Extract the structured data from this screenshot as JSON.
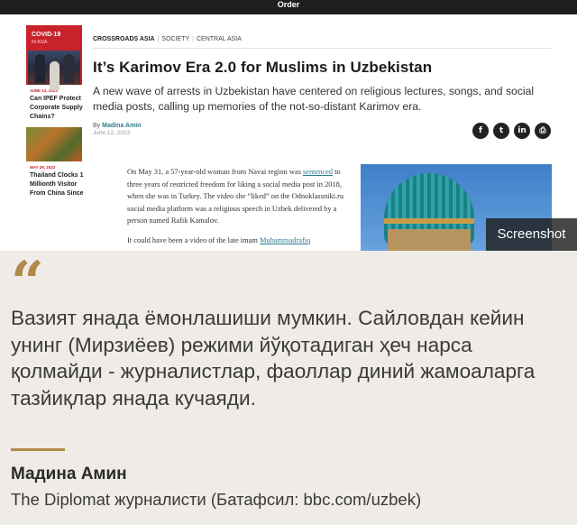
{
  "topbar": {
    "order_label": "Order"
  },
  "sidebar": {
    "promo": {
      "title": "COVID-19",
      "subtitle": "IN ASIA"
    },
    "items": [
      {
        "date": "JUNE 12, 2023",
        "title": "Can IPEF Protect Corporate Supply Chains?"
      },
      {
        "date": "MAY 29, 2023",
        "title": "Thailand Clocks 1 Millionth Visitor From China Since"
      }
    ]
  },
  "article": {
    "breadcrumb": {
      "section": "CROSSROADS ASIA",
      "category": "SOCIETY",
      "region": "CENTRAL ASIA"
    },
    "headline": "It’s Karimov Era 2.0 for Muslims in Uzbekistan",
    "dek": "A new wave of arrests in Uzbekistan have centered on religious lectures, songs, and social media posts, calling up memories of the not-so-distant Karimov era.",
    "by_prefix": "By",
    "author": "Madina Amin",
    "date": "June 12, 2023",
    "share_icons": [
      "facebook-icon",
      "twitter-icon",
      "linkedin-icon",
      "print-icon"
    ],
    "body": {
      "p1_before": "On May 31, a 57-year-old woman from Navai region was ",
      "p1_link": "sentenced",
      "p1_after": " to three years of restricted freedom for liking a social media post in 2018, when she was in Turkey. The video she “liked” on the Odnoklassniki.ru social media platform was a religious speech in Uzbek delivered by a person named Rafik Kamalov.",
      "p2_before": "It could have been a video of the late imam ",
      "p2_link": "Muhammadrafiq"
    }
  },
  "screenshot_tag": "Screenshot",
  "quote": {
    "mark": "“",
    "text": "Вазият янада ёмонлашиши мумкин. Сайловдан кейин унинг (Мирзиёев) режими йўқотадиган ҳеч нарса қолмайди - журналистлар, фаоллар диний жамоаларга тазйиқлар янада кучаяди.",
    "author": "Мадина Амин",
    "source": "The Diplomat журналисти (Батафсил: bbc.com/uzbek)"
  },
  "colors": {
    "accent_red": "#c8222a",
    "link_teal": "#2a7d8f",
    "quote_gold": "#b08a4c",
    "quote_bg": "#efebe6"
  }
}
